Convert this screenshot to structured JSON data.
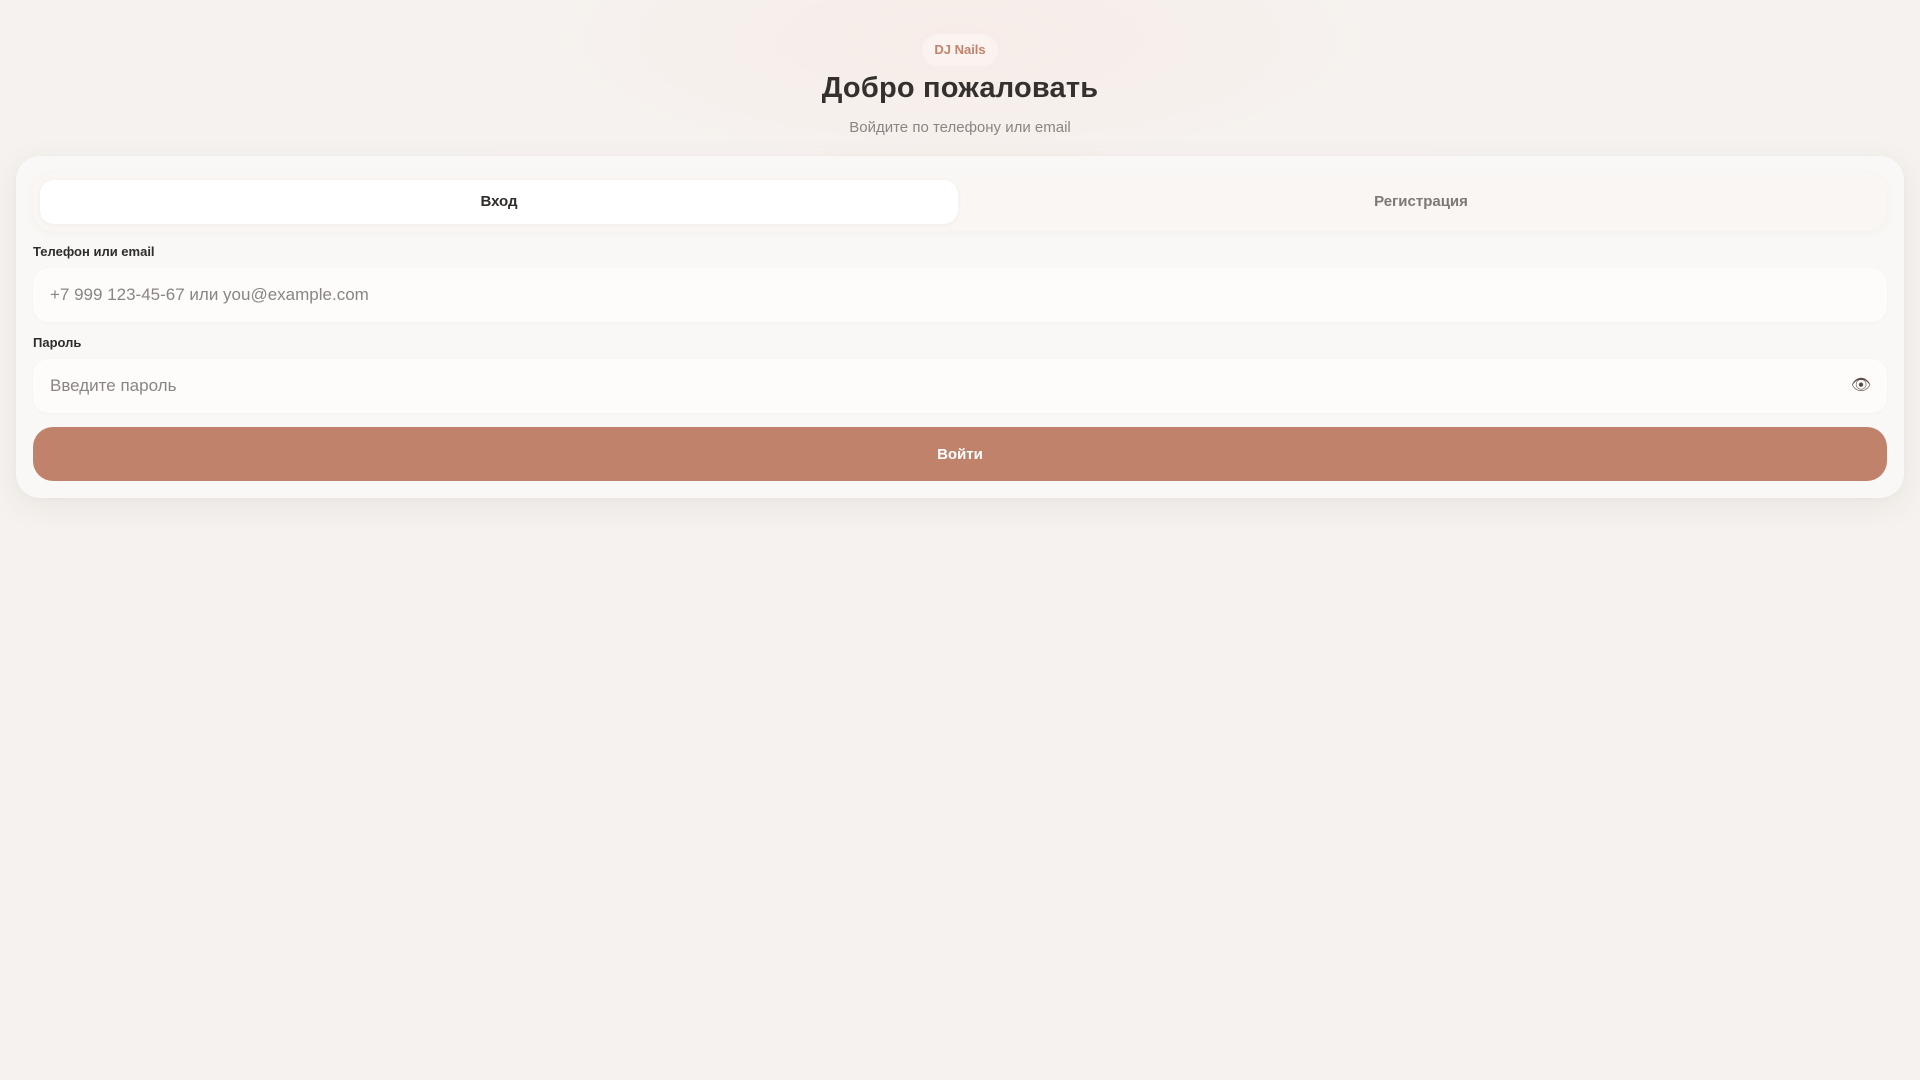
{
  "brand": {
    "name": "DJ Nails"
  },
  "header": {
    "title": "Добро пожаловать",
    "subtitle": "Войдите по телефону или email"
  },
  "tabs": {
    "login_label": "Вход",
    "register_label": "Регистрация",
    "active": "login"
  },
  "form": {
    "login_label": "Телефон или email",
    "login_placeholder": "+7 999 123-45-67 или you@example.com",
    "login_value": "",
    "password_label": "Пароль",
    "password_placeholder": "Введите пароль",
    "password_value": "",
    "password_toggle_icon": "eye-icon",
    "password_toggle_glyph": "👁",
    "submit_label": "Войти"
  },
  "colors": {
    "accent": "#c1826b",
    "brand_text": "#c2826c",
    "background": "#f5f2ef"
  }
}
